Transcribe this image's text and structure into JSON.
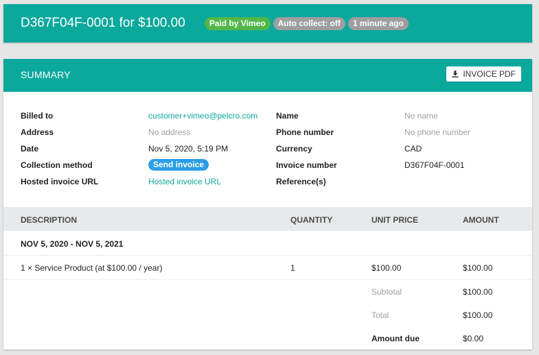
{
  "banner": {
    "title": "D367F04F-0001 for $100.00",
    "badges": [
      {
        "label": "Paid by Vimeo",
        "color": "#52b748"
      },
      {
        "label": "Auto collect: off",
        "color": "#9e9e9e"
      },
      {
        "label": "1 minute ago",
        "color": "#9e9e9e"
      }
    ]
  },
  "summary": {
    "title": "SUMMARY",
    "pdf_button": {
      "label": "INVOICE PDF",
      "icon": "download-icon"
    },
    "left_fields": {
      "billed_to": {
        "label": "Billed to",
        "value": "customer+vimeo@pelcro.com"
      },
      "address": {
        "label": "Address",
        "value": "No address"
      },
      "date": {
        "label": "Date",
        "value": "Nov 5, 2020, 5:19 PM"
      },
      "collection_method": {
        "label": "Collection method",
        "value": "Send invoice"
      },
      "hosted_invoice_url": {
        "label": "Hosted invoice URL",
        "value": "Hosted invoice URL"
      }
    },
    "right_fields": {
      "name": {
        "label": "Name",
        "value": "No name"
      },
      "phone": {
        "label": "Phone number",
        "value": "No phone number"
      },
      "currency": {
        "label": "Currency",
        "value": "CAD"
      },
      "invoice_number": {
        "label": "Invoice number",
        "value": "D367F04F-0001"
      },
      "references": {
        "label": "Reference(s)",
        "value": ""
      }
    }
  },
  "table": {
    "headers": {
      "description": "DESCRIPTION",
      "quantity": "QUANTITY",
      "unit_price": "UNIT PRICE",
      "amount": "AMOUNT"
    },
    "period": "NOV 5, 2020 - NOV 5, 2021",
    "line_items": [
      {
        "description": "1 × Service Product (at $100.00 / year)",
        "quantity": "1",
        "unit_price": "$100.00",
        "amount": "$100.00"
      }
    ],
    "totals": {
      "subtotal": {
        "label": "Subtotal",
        "value": "$100.00"
      },
      "total": {
        "label": "Total",
        "value": "$100.00"
      },
      "amount_due": {
        "label": "Amount due",
        "value": "$0.00"
      }
    }
  },
  "colors": {
    "brand": "#0ba89c",
    "link": "#0ba89c",
    "send_invoice": "#2a9fe6"
  }
}
